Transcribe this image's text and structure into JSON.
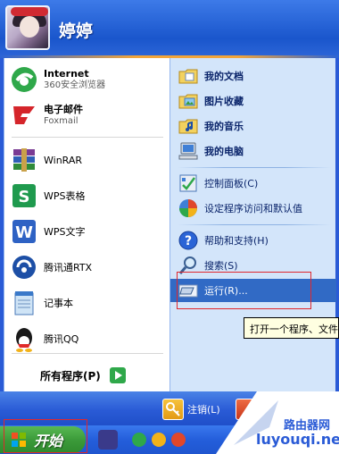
{
  "user": {
    "name": "婷婷"
  },
  "left_items": [
    {
      "title": "Internet",
      "subtitle": "360安全浏览器",
      "icon": "browser-360-icon",
      "pinned": true
    },
    {
      "title": "电子邮件",
      "subtitle": "Foxmail",
      "icon": "foxmail-icon",
      "pinned": true
    },
    {
      "title": "WinRAR",
      "icon": "winrar-icon"
    },
    {
      "title": "WPS表格",
      "icon": "wps-spreadsheet-icon"
    },
    {
      "title": "WPS文字",
      "icon": "wps-writer-icon"
    },
    {
      "title": "腾讯通RTX",
      "icon": "rtx-icon"
    },
    {
      "title": "记事本",
      "icon": "notepad-icon"
    },
    {
      "title": "腾讯QQ",
      "icon": "qq-icon"
    }
  ],
  "all_programs": "所有程序(P)",
  "right_items": [
    {
      "label": "我的文档",
      "icon": "my-documents-icon"
    },
    {
      "label": "图片收藏",
      "icon": "my-pictures-icon"
    },
    {
      "label": "我的音乐",
      "icon": "my-music-icon"
    },
    {
      "label": "我的电脑",
      "icon": "my-computer-icon"
    },
    {
      "label": "控制面板(C)",
      "icon": "control-panel-icon"
    },
    {
      "label": "设定程序访问和默认值",
      "icon": "default-programs-icon"
    },
    {
      "label": "帮助和支持(H)",
      "icon": "help-icon"
    },
    {
      "label": "搜索(S)",
      "icon": "search-icon"
    },
    {
      "label": "运行(R)...",
      "icon": "run-icon"
    }
  ],
  "bottom": {
    "logoff": "注销(L)"
  },
  "taskbar": {
    "start": "开始"
  },
  "tooltip": "打开一个程序、文件",
  "watermark": {
    "line1": "路由器网",
    "line2": "luyouqi.net"
  },
  "colors": {
    "accent_blue": "#2a5bd6",
    "highlight": "#316ac5",
    "start_green": "#3c9b3a",
    "annotation_red": "#e0272d"
  }
}
